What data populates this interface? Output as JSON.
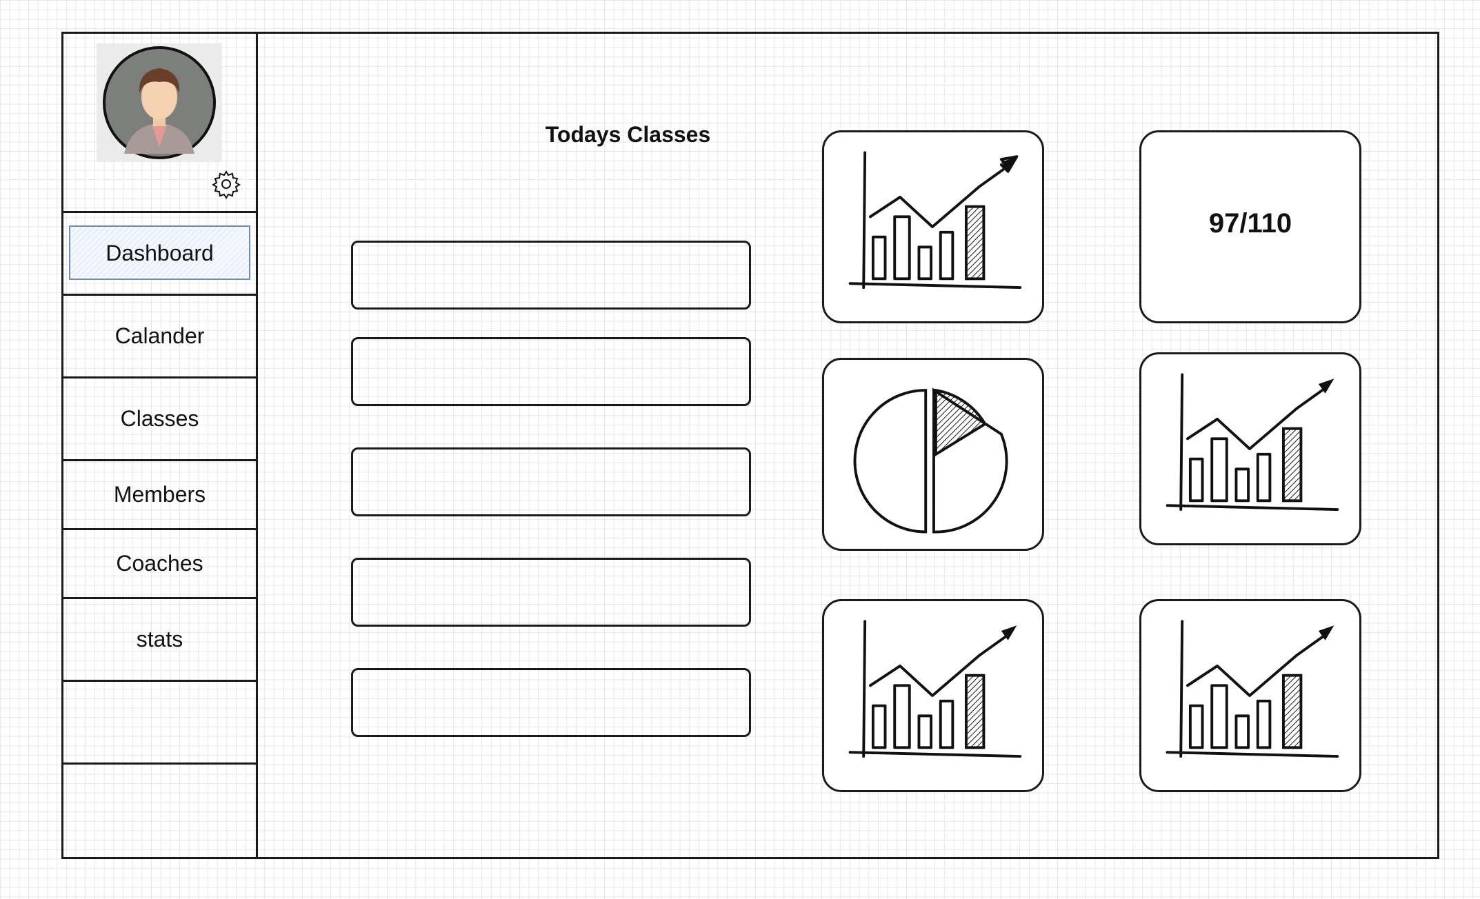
{
  "sidebar": {
    "profile": {
      "avatar_icon": "user-avatar",
      "settings_icon": "gear-icon"
    },
    "items": [
      {
        "label": "Dashboard",
        "active": true
      },
      {
        "label": "Calander"
      },
      {
        "label": "Classes"
      },
      {
        "label": "Members"
      },
      {
        "label": "Coaches"
      },
      {
        "label": "stats"
      },
      {
        "label": ""
      },
      {
        "label": ""
      }
    ]
  },
  "main": {
    "section_title": "Todays Classes",
    "class_slots": [
      "",
      "",
      "",
      "",
      ""
    ],
    "cards": [
      {
        "type": "bar-chart-icon"
      },
      {
        "type": "stat",
        "value": "97/110"
      },
      {
        "type": "pie-chart-icon"
      },
      {
        "type": "bar-chart-icon"
      },
      {
        "type": "bar-chart-icon"
      },
      {
        "type": "bar-chart-icon"
      }
    ]
  },
  "colors": {
    "stroke": "#1a1a1a",
    "active_fill": "#dae8fc",
    "active_border": "#6c8ebf",
    "grid": "#e6e6e6"
  }
}
